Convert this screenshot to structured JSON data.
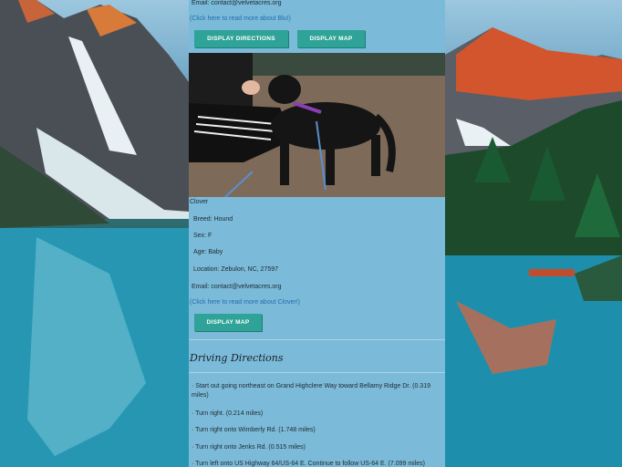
{
  "pet1": {
    "email": "Email: contact@velvetacres.org",
    "read_more": "(Click here to read more about Blu!)",
    "btn_directions": "DISPLAY DIRECTIONS",
    "btn_map": "DISPLAY MAP"
  },
  "pet2": {
    "name": "Clover",
    "breed": "Breed: Hound",
    "sex": "Sex: F",
    "age": "Age: Baby",
    "location": "Location: Zebulon, NC, 27597",
    "email": "Email: contact@velvetacres.org",
    "read_more": "(Click here to read more about Clover!)",
    "btn_map": "DISPLAY MAP"
  },
  "directions": {
    "heading": "Driving Directions",
    "steps": [
      "· Start out going northeast on Grand Highclere Way toward Bellamy Ridge Dr. (0.319 miles)",
      "· Turn right. (0.214 miles)",
      "· Turn right onto Wimberly Rd. (1.748 miles)",
      "· Turn right onto Jenks Rd. (0.515 miles)",
      "· Turn left onto US Highway 64/US-64 E. Continue to follow US-64 E. (7.099 miles)"
    ]
  },
  "colors": {
    "column_bg": "#7bbad8",
    "button_bg": "#2fa398",
    "link": "#1f6fb0"
  }
}
